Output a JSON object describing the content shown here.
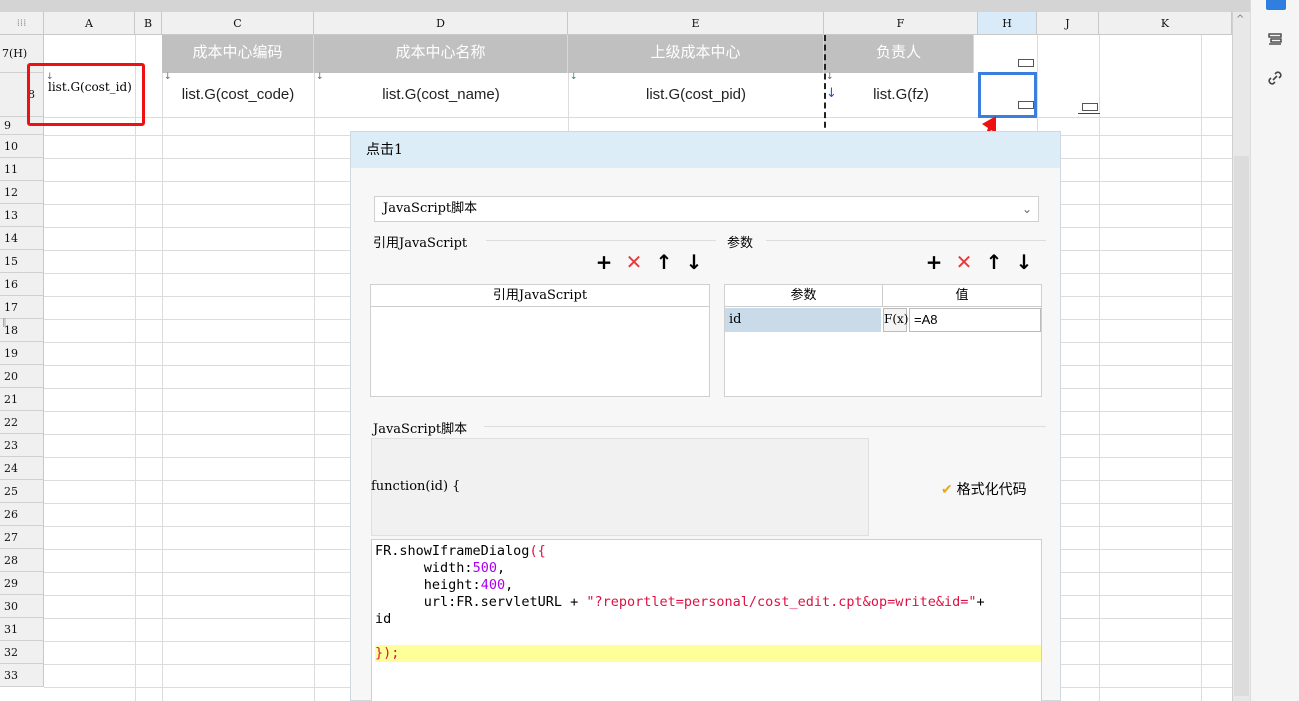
{
  "columns": [
    {
      "label": "A",
      "selected": false
    },
    {
      "label": "B",
      "selected": false
    },
    {
      "label": "C",
      "selected": false
    },
    {
      "label": "D",
      "selected": false
    },
    {
      "label": "E",
      "selected": false
    },
    {
      "label": "F",
      "selected": false
    },
    {
      "label": "H",
      "selected": true
    },
    {
      "label": "J",
      "selected": false
    },
    {
      "label": "K",
      "selected": false
    }
  ],
  "rows": [
    "7(H)",
    "8",
    "9",
    "10",
    "11",
    "12",
    "13",
    "14",
    "15",
    "16",
    "17",
    "18",
    "19",
    "20",
    "21",
    "22",
    "23",
    "24",
    "25",
    "26",
    "27",
    "28",
    "29",
    "30",
    "31",
    "32",
    "33"
  ],
  "header_cells": [
    "成本中心编码",
    "成本中心名称",
    "上级成本中心",
    "负责人"
  ],
  "data_cells": {
    "a8": "list.G(cost_id)",
    "c8": "list.G(cost_code)",
    "d8": "list.G(cost_name)",
    "e8": "list.G(cost_pid)",
    "f8": "list.G(fz)"
  },
  "dialog": {
    "title": "点击1",
    "type_select": "JavaScript脚本",
    "ref_section": "引用JavaScript",
    "ref_column": "引用JavaScript",
    "param_section": "参数",
    "param_columns": [
      "参数",
      "值"
    ],
    "params": [
      {
        "name": "id",
        "value": "=A8"
      }
    ],
    "script_section": "JavaScript脚本",
    "function_signature": "function(id) {",
    "format_button": "格式化代码",
    "code": {
      "l1": "FR.showIframeDialog",
      "l1b": "({",
      "l2": "width:",
      "l2n": "500",
      "l3": "height:",
      "l3n": "400",
      "l4": "url:FR.servletURL + ",
      "l4s": "\"?reportlet=personal/cost_edit.cpt&op=write&id=\"",
      "l4e": "+",
      "l5": "id",
      "l7": "});"
    }
  },
  "colors": {
    "accent": "#3a7fdd",
    "highlight": "#ee1111",
    "header_gray": "#c0c0c0"
  }
}
